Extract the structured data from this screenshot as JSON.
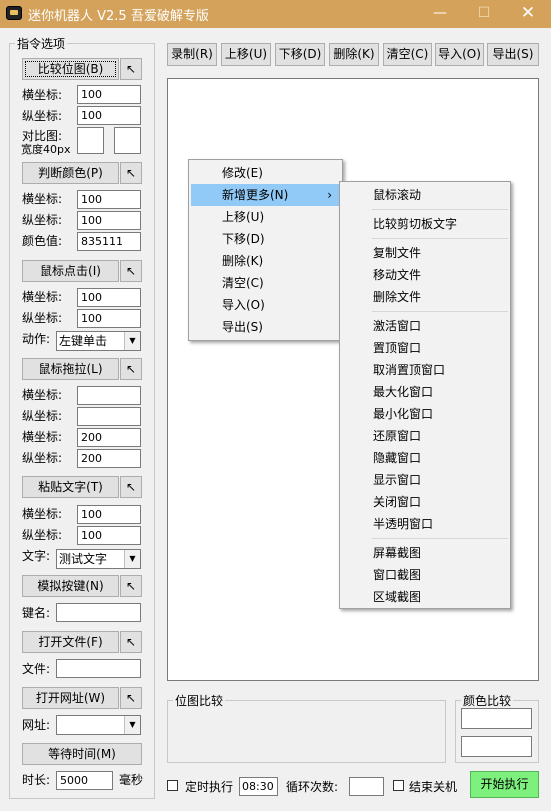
{
  "window": {
    "title": "迷你机器人 V2.5 吾爱破解专版",
    "min_label": "—",
    "max_label": "☐",
    "close_label": "✕"
  },
  "left_panel": {
    "group_title": "指令选项",
    "arrow_label": "↖",
    "compare_image_button": "比较位图(B)",
    "compare_x_label": "横坐标:",
    "compare_x_value": "100",
    "compare_y_label": "纵坐标:",
    "compare_y_value": "100",
    "compare_img_label": "对比图:",
    "compare_width_label": "宽度40px",
    "judge_color_button": "判断颜色(P)",
    "judge_x_label": "横坐标:",
    "judge_x_value": "100",
    "judge_y_label": "纵坐标:",
    "judge_y_value": "100",
    "color_value_label": "颜色值:",
    "color_value": "835111",
    "mouse_click_button": "鼠标点击(I)",
    "click_x_label": "横坐标:",
    "click_x_value": "100",
    "click_y_label": "纵坐标:",
    "click_y_value": "100",
    "action_label": "动作:",
    "action_value": "左键单击",
    "mouse_drag_button": "鼠标拖拉(L)",
    "drag_x1_label": "横坐标:",
    "drag_x1_value": "",
    "drag_y1_label": "纵坐标:",
    "drag_y1_value": "",
    "drag_x2_label": "横坐标:",
    "drag_x2_value": "200",
    "drag_y2_label": "纵坐标:",
    "drag_y2_value": "200",
    "paste_text_button": "粘贴文字(T)",
    "paste_x_label": "横坐标:",
    "paste_x_value": "100",
    "paste_y_label": "纵坐标:",
    "paste_y_value": "100",
    "text_label": "文字:",
    "text_value": "测试文字",
    "simulate_key_button": "模拟按键(N)",
    "key_name_label": "键名:",
    "key_name_value": "",
    "open_file_button": "打开文件(F)",
    "file_label": "文件:",
    "file_value": "",
    "open_url_button": "打开网址(W)",
    "url_label": "网址:",
    "url_value": "",
    "wait_time_button": "等待时间(M)",
    "duration_label": "时长:",
    "duration_value": "5000",
    "duration_unit": "毫秒"
  },
  "toolbar": {
    "record": "录制(R)",
    "move_up": "上移(U)",
    "move_down": "下移(D)",
    "delete": "删除(K)",
    "clear": "清空(C)",
    "import": "导入(O)",
    "export": "导出(S)"
  },
  "context_menu": {
    "items": [
      "修改(E)",
      "新增更多(N)",
      "上移(U)",
      "下移(D)",
      "删除(K)",
      "清空(C)",
      "导入(O)",
      "导出(S)"
    ],
    "submenu_arrow": "›"
  },
  "submenu": {
    "group1": [
      "鼠标滚动"
    ],
    "group2": [
      "比较剪切板文字"
    ],
    "group3": [
      "复制文件",
      "移动文件",
      "删除文件"
    ],
    "group4": [
      "激活窗口",
      "置顶窗口",
      "取消置顶窗口",
      "最大化窗口",
      "最小化窗口",
      "还原窗口",
      "隐藏窗口",
      "显示窗口",
      "关闭窗口",
      "半透明窗口"
    ],
    "group5": [
      "屏幕截图",
      "窗口截图",
      "区域截图"
    ]
  },
  "bottom": {
    "image_compare_title": "位图比较",
    "color_compare_title": "颜色比较",
    "timed_exec_label": "定时执行",
    "timed_exec_value": "08:30",
    "loop_count_label": "循环次数:",
    "loop_count_value": "",
    "shutdown_label": "结束关机",
    "start_button": "开始执行"
  },
  "colors": {
    "titlebar": "#d4a25a",
    "menu_highlight": "#91c9f7",
    "start_button": "#7ef07e"
  }
}
